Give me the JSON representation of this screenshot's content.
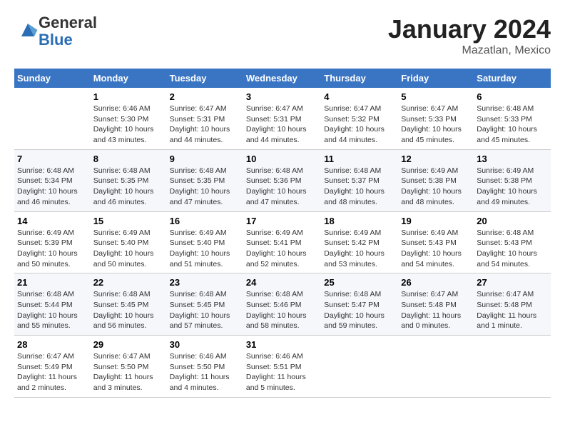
{
  "header": {
    "logo_general": "General",
    "logo_blue": "Blue",
    "month_title": "January 2024",
    "subtitle": "Mazatlan, Mexico"
  },
  "days_of_week": [
    "Sunday",
    "Monday",
    "Tuesday",
    "Wednesday",
    "Thursday",
    "Friday",
    "Saturday"
  ],
  "weeks": [
    [
      {
        "day": "",
        "info": ""
      },
      {
        "day": "1",
        "info": "Sunrise: 6:46 AM\nSunset: 5:30 PM\nDaylight: 10 hours\nand 43 minutes."
      },
      {
        "day": "2",
        "info": "Sunrise: 6:47 AM\nSunset: 5:31 PM\nDaylight: 10 hours\nand 44 minutes."
      },
      {
        "day": "3",
        "info": "Sunrise: 6:47 AM\nSunset: 5:31 PM\nDaylight: 10 hours\nand 44 minutes."
      },
      {
        "day": "4",
        "info": "Sunrise: 6:47 AM\nSunset: 5:32 PM\nDaylight: 10 hours\nand 44 minutes."
      },
      {
        "day": "5",
        "info": "Sunrise: 6:47 AM\nSunset: 5:33 PM\nDaylight: 10 hours\nand 45 minutes."
      },
      {
        "day": "6",
        "info": "Sunrise: 6:48 AM\nSunset: 5:33 PM\nDaylight: 10 hours\nand 45 minutes."
      }
    ],
    [
      {
        "day": "7",
        "info": "Sunrise: 6:48 AM\nSunset: 5:34 PM\nDaylight: 10 hours\nand 46 minutes."
      },
      {
        "day": "8",
        "info": "Sunrise: 6:48 AM\nSunset: 5:35 PM\nDaylight: 10 hours\nand 46 minutes."
      },
      {
        "day": "9",
        "info": "Sunrise: 6:48 AM\nSunset: 5:35 PM\nDaylight: 10 hours\nand 47 minutes."
      },
      {
        "day": "10",
        "info": "Sunrise: 6:48 AM\nSunset: 5:36 PM\nDaylight: 10 hours\nand 47 minutes."
      },
      {
        "day": "11",
        "info": "Sunrise: 6:48 AM\nSunset: 5:37 PM\nDaylight: 10 hours\nand 48 minutes."
      },
      {
        "day": "12",
        "info": "Sunrise: 6:49 AM\nSunset: 5:38 PM\nDaylight: 10 hours\nand 48 minutes."
      },
      {
        "day": "13",
        "info": "Sunrise: 6:49 AM\nSunset: 5:38 PM\nDaylight: 10 hours\nand 49 minutes."
      }
    ],
    [
      {
        "day": "14",
        "info": "Sunrise: 6:49 AM\nSunset: 5:39 PM\nDaylight: 10 hours\nand 50 minutes."
      },
      {
        "day": "15",
        "info": "Sunrise: 6:49 AM\nSunset: 5:40 PM\nDaylight: 10 hours\nand 50 minutes."
      },
      {
        "day": "16",
        "info": "Sunrise: 6:49 AM\nSunset: 5:40 PM\nDaylight: 10 hours\nand 51 minutes."
      },
      {
        "day": "17",
        "info": "Sunrise: 6:49 AM\nSunset: 5:41 PM\nDaylight: 10 hours\nand 52 minutes."
      },
      {
        "day": "18",
        "info": "Sunrise: 6:49 AM\nSunset: 5:42 PM\nDaylight: 10 hours\nand 53 minutes."
      },
      {
        "day": "19",
        "info": "Sunrise: 6:49 AM\nSunset: 5:43 PM\nDaylight: 10 hours\nand 54 minutes."
      },
      {
        "day": "20",
        "info": "Sunrise: 6:48 AM\nSunset: 5:43 PM\nDaylight: 10 hours\nand 54 minutes."
      }
    ],
    [
      {
        "day": "21",
        "info": "Sunrise: 6:48 AM\nSunset: 5:44 PM\nDaylight: 10 hours\nand 55 minutes."
      },
      {
        "day": "22",
        "info": "Sunrise: 6:48 AM\nSunset: 5:45 PM\nDaylight: 10 hours\nand 56 minutes."
      },
      {
        "day": "23",
        "info": "Sunrise: 6:48 AM\nSunset: 5:45 PM\nDaylight: 10 hours\nand 57 minutes."
      },
      {
        "day": "24",
        "info": "Sunrise: 6:48 AM\nSunset: 5:46 PM\nDaylight: 10 hours\nand 58 minutes."
      },
      {
        "day": "25",
        "info": "Sunrise: 6:48 AM\nSunset: 5:47 PM\nDaylight: 10 hours\nand 59 minutes."
      },
      {
        "day": "26",
        "info": "Sunrise: 6:47 AM\nSunset: 5:48 PM\nDaylight: 11 hours\nand 0 minutes."
      },
      {
        "day": "27",
        "info": "Sunrise: 6:47 AM\nSunset: 5:48 PM\nDaylight: 11 hours\nand 1 minute."
      }
    ],
    [
      {
        "day": "28",
        "info": "Sunrise: 6:47 AM\nSunset: 5:49 PM\nDaylight: 11 hours\nand 2 minutes."
      },
      {
        "day": "29",
        "info": "Sunrise: 6:47 AM\nSunset: 5:50 PM\nDaylight: 11 hours\nand 3 minutes."
      },
      {
        "day": "30",
        "info": "Sunrise: 6:46 AM\nSunset: 5:50 PM\nDaylight: 11 hours\nand 4 minutes."
      },
      {
        "day": "31",
        "info": "Sunrise: 6:46 AM\nSunset: 5:51 PM\nDaylight: 11 hours\nand 5 minutes."
      },
      {
        "day": "",
        "info": ""
      },
      {
        "day": "",
        "info": ""
      },
      {
        "day": "",
        "info": ""
      }
    ]
  ]
}
